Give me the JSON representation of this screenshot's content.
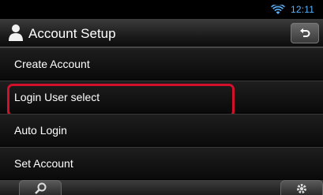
{
  "status": {
    "time": "12:11",
    "wifi_icon": "wifi-icon"
  },
  "header": {
    "title": "Account Setup",
    "user_icon": "user-icon",
    "back_icon": "back-arrow-icon"
  },
  "menu": {
    "items": [
      {
        "label": "Create Account",
        "highlighted": false
      },
      {
        "label": "Login User select",
        "highlighted": true
      },
      {
        "label": "Auto Login",
        "highlighted": false
      },
      {
        "label": "Set Account",
        "highlighted": false
      }
    ]
  },
  "bottom": {
    "left_icon": "search-icon",
    "right_icon": "gear-icon"
  },
  "colors": {
    "highlight": "#d3102b",
    "time": "#5ab3ff"
  }
}
